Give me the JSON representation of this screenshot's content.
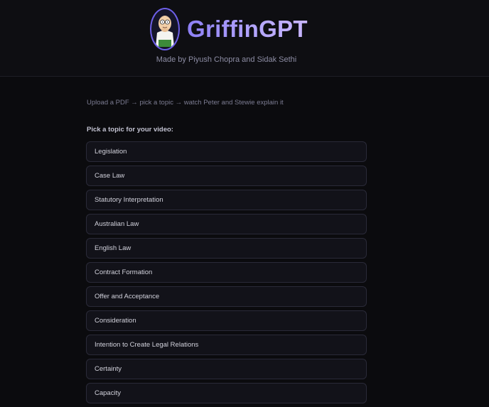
{
  "app": {
    "title": "GriffinGPT",
    "byline": "Made by Piyush Chopra and Sidak Sethi",
    "avatar_icon": "peter-griffin-avatar-icon"
  },
  "main": {
    "tagline": "Upload a PDF → pick a topic → watch Peter and Stewie explain it",
    "section_label": "Pick a topic for your video:",
    "topics": [
      {
        "label": "Legislation"
      },
      {
        "label": "Case Law"
      },
      {
        "label": "Statutory Interpretation"
      },
      {
        "label": "Australian Law"
      },
      {
        "label": "English Law"
      },
      {
        "label": "Contract Formation"
      },
      {
        "label": "Offer and Acceptance"
      },
      {
        "label": "Consideration"
      },
      {
        "label": "Intention to Create Legal Relations"
      },
      {
        "label": "Certainty"
      },
      {
        "label": "Capacity"
      }
    ]
  },
  "colors": {
    "accent": "#8d7ff5",
    "background": "#0b0b0e",
    "card": "#121219"
  }
}
